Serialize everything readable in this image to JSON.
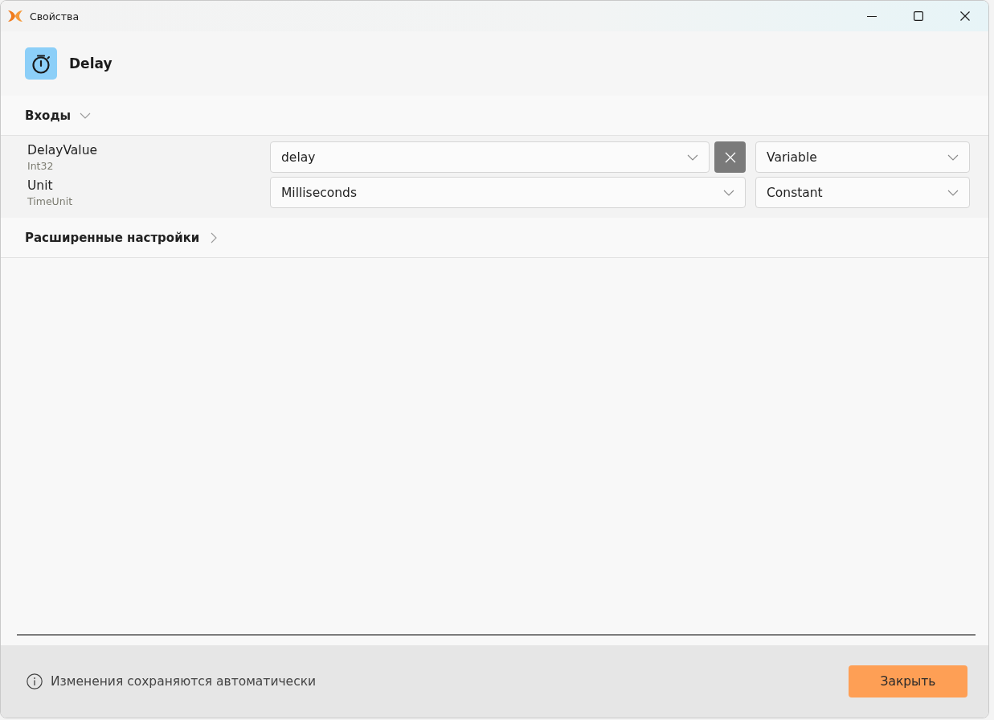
{
  "window": {
    "title": "Свойства"
  },
  "header": {
    "title": "Delay"
  },
  "sections": [
    {
      "title": "Входы",
      "expanded": true,
      "params": [
        {
          "name": "DelayValue",
          "type": "Int32",
          "value": "delay",
          "clearable": true,
          "mode": "Variable"
        },
        {
          "name": "Unit",
          "type": "TimeUnit",
          "value": "Milliseconds",
          "clearable": false,
          "mode": "Constant"
        }
      ]
    },
    {
      "title": "Расширенные настройки",
      "expanded": false
    }
  ],
  "footer": {
    "note": "Изменения сохраняются автоматически",
    "close_button": "Закрыть"
  }
}
